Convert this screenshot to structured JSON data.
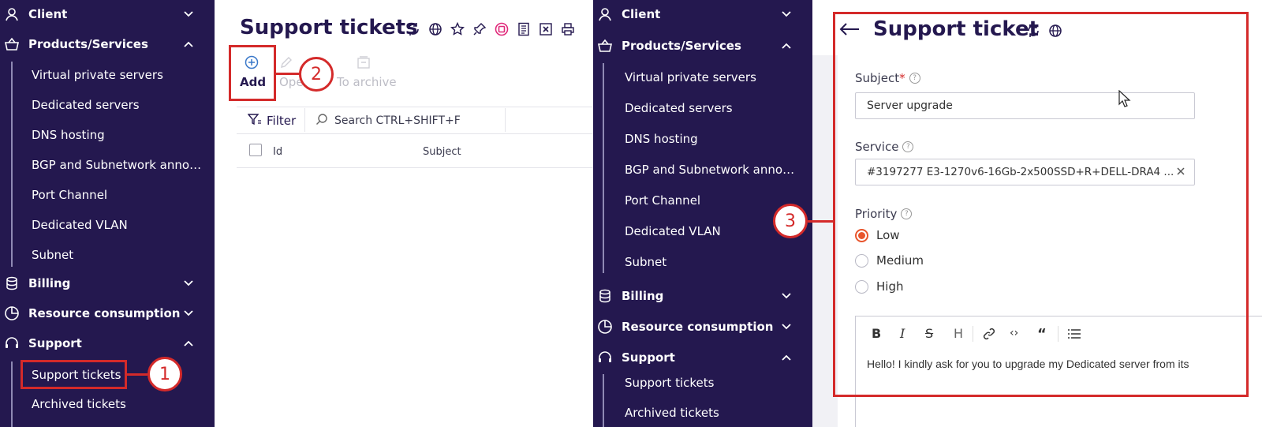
{
  "left_sidebar": {
    "client": "Client",
    "products": "Products/Services",
    "sub": [
      "Virtual private servers",
      "Dedicated servers",
      "DNS hosting",
      "BGP and Subnetwork anno…",
      "Port Channel",
      "Dedicated VLAN",
      "Subnet"
    ],
    "billing": "Billing",
    "resource": "Resource consumption",
    "support": "Support",
    "support_sub": [
      "Support tickets",
      "Archived tickets"
    ]
  },
  "list_page": {
    "title": "Support tickets",
    "add": "Add",
    "open": "Ope",
    "archive": "To archive",
    "filter": "Filter",
    "search": "Search CTRL+SHIFT+F",
    "col_id": "Id",
    "col_subject": "Subject"
  },
  "right_sidebar": {
    "client": "Client",
    "products": "Products/Services",
    "sub": [
      "Virtual private servers",
      "Dedicated servers",
      "DNS hosting",
      "BGP and Subnetwork anno…",
      "Port Channel",
      "Dedicated VLAN",
      "Subnet"
    ],
    "billing": "Billing",
    "resource": "Resource consumption",
    "support": "Support",
    "support_sub": [
      "Support tickets",
      "Archived tickets"
    ]
  },
  "ticket_form": {
    "title": "Support ticket",
    "subject_label": "Subject",
    "required_mark": "*",
    "subject_value": "Server upgrade",
    "service_label": "Service",
    "service_value": "#3197277 E3-1270v6-16Gb-2x500SSD+R+DELL-DRA4 ...",
    "priority_label": "Priority",
    "priorities": [
      "Low",
      "Medium",
      "High"
    ],
    "selected_priority": "Low",
    "editor_text": "Hello! I kindly ask for you to upgrade my Dedicated server from its"
  },
  "callouts": [
    "1",
    "2",
    "3"
  ],
  "colors": {
    "sidebar_bg": "#24184f",
    "accent_red": "#d42a2a",
    "radio_orange": "#e8552c",
    "add_blue": "#3a78c9"
  }
}
